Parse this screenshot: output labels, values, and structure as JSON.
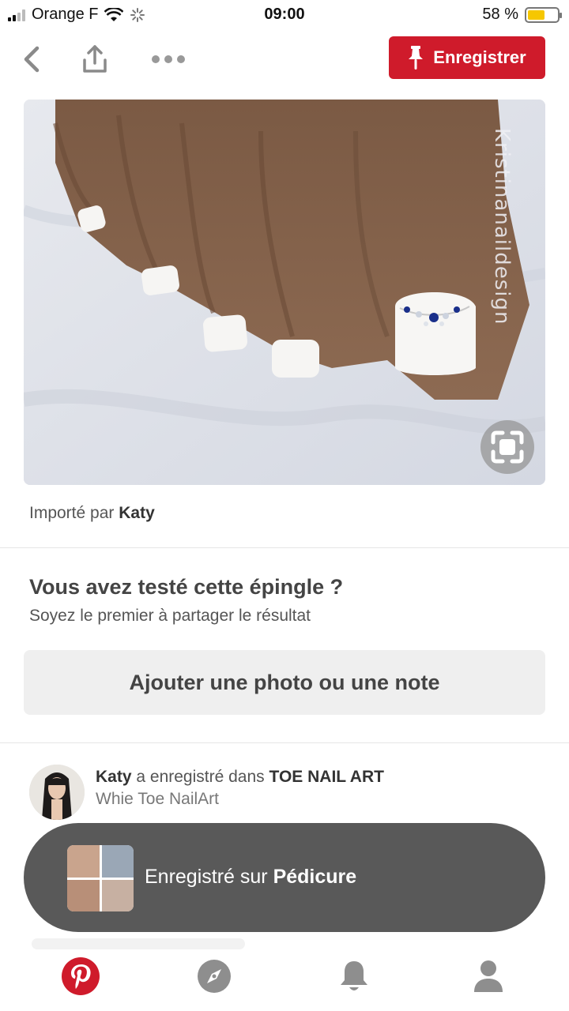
{
  "status_bar": {
    "carrier": "Orange F",
    "time": "09:00",
    "battery_percent": "58 %",
    "battery_level": 0.58,
    "signal_icon": "signal-bars-icon",
    "wifi_icon": "wifi-icon",
    "activity_icon": "loading-spinner-icon"
  },
  "nav": {
    "back_icon": "chevron-left-icon",
    "share_icon": "share-icon",
    "more_icon": "ellipsis-icon",
    "save_label": "Enregistrer",
    "save_icon": "pushpin-icon"
  },
  "pin": {
    "image_description_icon": "photo",
    "watermark": "Kristinanaildesign",
    "lens_icon": "visual-search-icon"
  },
  "imported": {
    "prefix": "Importé par",
    "user": "Katy"
  },
  "tried": {
    "title": "Vous avez testé cette épingle ?",
    "subtitle": "Soyez le premier à partager le résultat",
    "button_label": "Ajouter une photo ou une note"
  },
  "activity": {
    "user": "Katy",
    "action": "a enregistré dans",
    "board": "TOE NAIL ART",
    "description": "Whie Toe NailArt"
  },
  "toast": {
    "prefix": "Enregistré sur",
    "board": "Pédicure"
  },
  "tabbar": {
    "home_icon": "pinterest-logo-icon",
    "explore_icon": "compass-icon",
    "notifications_icon": "bell-icon",
    "profile_icon": "person-icon"
  },
  "colors": {
    "brand_red": "#cf1b2b",
    "toast_bg": "#595959",
    "battery_yellow": "#f6c700"
  }
}
